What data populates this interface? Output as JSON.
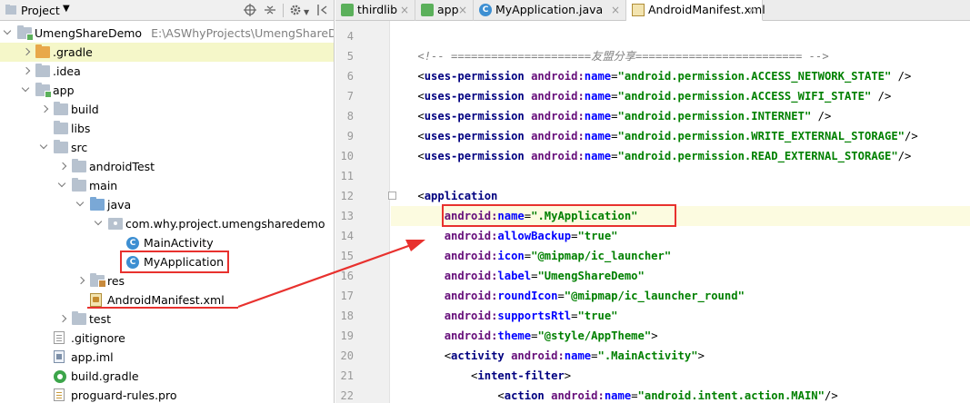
{
  "project_panel": {
    "title": "Project",
    "toolbar_icons": [
      "target-icon",
      "collapse-icon",
      "gear-icon",
      "hide-icon"
    ],
    "tree": [
      {
        "label": "UmengShareDemo",
        "path": "E:\\ASWhyProjects\\UmengShareDemo",
        "icon": "module-folder-icon",
        "arrow": "expanded",
        "depth": 0
      },
      {
        "label": ".gradle",
        "icon": "orange-folder-icon",
        "arrow": "collapsed",
        "depth": 1,
        "selected": true
      },
      {
        "label": ".idea",
        "icon": "folder-icon",
        "arrow": "collapsed",
        "depth": 1
      },
      {
        "label": "app",
        "icon": "module-folder-icon",
        "arrow": "expanded",
        "depth": 1
      },
      {
        "label": "build",
        "icon": "folder-icon",
        "arrow": "collapsed",
        "depth": 2
      },
      {
        "label": "libs",
        "icon": "folder-icon",
        "arrow": "none",
        "depth": 2
      },
      {
        "label": "src",
        "icon": "folder-icon",
        "arrow": "expanded",
        "depth": 2
      },
      {
        "label": "androidTest",
        "icon": "folder-icon",
        "arrow": "collapsed",
        "depth": 3
      },
      {
        "label": "main",
        "icon": "folder-icon",
        "arrow": "expanded",
        "depth": 3
      },
      {
        "label": "java",
        "icon": "source-folder-icon",
        "arrow": "expanded",
        "depth": 4
      },
      {
        "label": "com.why.project.umengsharedemo",
        "icon": "package-icon",
        "arrow": "expanded",
        "depth": 5
      },
      {
        "label": "MainActivity",
        "icon": "java-class-icon",
        "arrow": "none",
        "depth": 6
      },
      {
        "label": "MyApplication",
        "icon": "java-class-icon",
        "arrow": "none",
        "depth": 6,
        "highlight": true
      },
      {
        "label": "res",
        "icon": "res-folder-icon",
        "arrow": "collapsed",
        "depth": 4
      },
      {
        "label": "AndroidManifest.xml",
        "icon": "manifest-file-icon",
        "arrow": "none",
        "depth": 4,
        "underline": true
      },
      {
        "label": "test",
        "icon": "folder-icon",
        "arrow": "collapsed",
        "depth": 3
      },
      {
        "label": ".gitignore",
        "icon": "gitignore-file-icon",
        "arrow": "none",
        "depth": 2
      },
      {
        "label": "app.iml",
        "icon": "iml-file-icon",
        "arrow": "none",
        "depth": 2
      },
      {
        "label": "build.gradle",
        "icon": "gradle-file-icon",
        "arrow": "none",
        "depth": 2
      },
      {
        "label": "proguard-rules.pro",
        "icon": "pro-file-icon",
        "arrow": "none",
        "depth": 2
      }
    ]
  },
  "editor": {
    "tabs": [
      {
        "label": "thirdlib",
        "icon": "module-icon",
        "active": false
      },
      {
        "label": "app",
        "icon": "module-icon",
        "active": false
      },
      {
        "label": "MyApplication.java",
        "icon": "java-class-icon",
        "active": false
      },
      {
        "label": "AndroidManifest.xml",
        "icon": "manifest-file-icon",
        "active": true
      }
    ],
    "close_glyph": "×",
    "lines": [
      {
        "n": "4",
        "tokens": []
      },
      {
        "n": "5",
        "tokens": [
          {
            "t": "    ",
            "c": ""
          },
          {
            "t": "<!-- =====================友盟分享========================= -->",
            "c": "cmt"
          }
        ]
      },
      {
        "n": "6",
        "tokens": [
          {
            "t": "    <",
            "c": "br"
          },
          {
            "t": "uses-permission ",
            "c": "tag"
          },
          {
            "t": "android:",
            "c": "attr"
          },
          {
            "t": "name",
            "c": "attrp"
          },
          {
            "t": "=",
            "c": "br"
          },
          {
            "t": "\"android.permission.ACCESS_NETWORK_STATE\"",
            "c": "str"
          },
          {
            "t": " />",
            "c": "br"
          }
        ]
      },
      {
        "n": "7",
        "tokens": [
          {
            "t": "    <",
            "c": "br"
          },
          {
            "t": "uses-permission ",
            "c": "tag"
          },
          {
            "t": "android:",
            "c": "attr"
          },
          {
            "t": "name",
            "c": "attrp"
          },
          {
            "t": "=",
            "c": "br"
          },
          {
            "t": "\"android.permission.ACCESS_WIFI_STATE\"",
            "c": "str"
          },
          {
            "t": " />",
            "c": "br"
          }
        ]
      },
      {
        "n": "8",
        "tokens": [
          {
            "t": "    <",
            "c": "br"
          },
          {
            "t": "uses-permission ",
            "c": "tag"
          },
          {
            "t": "android:",
            "c": "attr"
          },
          {
            "t": "name",
            "c": "attrp"
          },
          {
            "t": "=",
            "c": "br"
          },
          {
            "t": "\"android.permission.INTERNET\"",
            "c": "str"
          },
          {
            "t": " />",
            "c": "br"
          }
        ]
      },
      {
        "n": "9",
        "tokens": [
          {
            "t": "    <",
            "c": "br"
          },
          {
            "t": "uses-permission ",
            "c": "tag"
          },
          {
            "t": "android:",
            "c": "attr"
          },
          {
            "t": "name",
            "c": "attrp"
          },
          {
            "t": "=",
            "c": "br"
          },
          {
            "t": "\"android.permission.WRITE_EXTERNAL_STORAGE\"",
            "c": "str"
          },
          {
            "t": "/>",
            "c": "br"
          }
        ]
      },
      {
        "n": "10",
        "tokens": [
          {
            "t": "    <",
            "c": "br"
          },
          {
            "t": "uses-permission ",
            "c": "tag"
          },
          {
            "t": "android:",
            "c": "attr"
          },
          {
            "t": "name",
            "c": "attrp"
          },
          {
            "t": "=",
            "c": "br"
          },
          {
            "t": "\"android.permission.READ_EXTERNAL_STORAGE\"",
            "c": "str"
          },
          {
            "t": "/>",
            "c": "br"
          }
        ]
      },
      {
        "n": "11",
        "tokens": []
      },
      {
        "n": "12",
        "tokens": [
          {
            "t": "    <",
            "c": "br"
          },
          {
            "t": "application",
            "c": "tag"
          }
        ]
      },
      {
        "n": "13",
        "tokens": [
          {
            "t": "        ",
            "c": ""
          },
          {
            "t": "android:",
            "c": "attr"
          },
          {
            "t": "name",
            "c": "attrp"
          },
          {
            "t": "=",
            "c": "br"
          },
          {
            "t": "\".MyApplication\"",
            "c": "str"
          }
        ],
        "highlight": true
      },
      {
        "n": "14",
        "tokens": [
          {
            "t": "        ",
            "c": ""
          },
          {
            "t": "android:",
            "c": "attr"
          },
          {
            "t": "allowBackup",
            "c": "attrp"
          },
          {
            "t": "=",
            "c": "br"
          },
          {
            "t": "\"true\"",
            "c": "str"
          }
        ]
      },
      {
        "n": "15",
        "tokens": [
          {
            "t": "        ",
            "c": ""
          },
          {
            "t": "android:",
            "c": "attr"
          },
          {
            "t": "icon",
            "c": "attrp"
          },
          {
            "t": "=",
            "c": "br"
          },
          {
            "t": "\"@mipmap/ic_launcher\"",
            "c": "str"
          }
        ]
      },
      {
        "n": "16",
        "tokens": [
          {
            "t": "        ",
            "c": ""
          },
          {
            "t": "android:",
            "c": "attr"
          },
          {
            "t": "label",
            "c": "attrp"
          },
          {
            "t": "=",
            "c": "br"
          },
          {
            "t": "\"UmengShareDemo\"",
            "c": "str"
          }
        ]
      },
      {
        "n": "17",
        "tokens": [
          {
            "t": "        ",
            "c": ""
          },
          {
            "t": "android:",
            "c": "attr"
          },
          {
            "t": "roundIcon",
            "c": "attrp"
          },
          {
            "t": "=",
            "c": "br"
          },
          {
            "t": "\"@mipmap/ic_launcher_round\"",
            "c": "str"
          }
        ]
      },
      {
        "n": "18",
        "tokens": [
          {
            "t": "        ",
            "c": ""
          },
          {
            "t": "android:",
            "c": "attr"
          },
          {
            "t": "supportsRtl",
            "c": "attrp"
          },
          {
            "t": "=",
            "c": "br"
          },
          {
            "t": "\"true\"",
            "c": "str"
          }
        ]
      },
      {
        "n": "19",
        "tokens": [
          {
            "t": "        ",
            "c": ""
          },
          {
            "t": "android:",
            "c": "attr"
          },
          {
            "t": "theme",
            "c": "attrp"
          },
          {
            "t": "=",
            "c": "br"
          },
          {
            "t": "\"@style/AppTheme\"",
            "c": "str"
          },
          {
            "t": ">",
            "c": "br"
          }
        ]
      },
      {
        "n": "20",
        "tokens": [
          {
            "t": "        <",
            "c": "br"
          },
          {
            "t": "activity ",
            "c": "tag"
          },
          {
            "t": "android:",
            "c": "attr"
          },
          {
            "t": "name",
            "c": "attrp"
          },
          {
            "t": "=",
            "c": "br"
          },
          {
            "t": "\".MainActivity\"",
            "c": "str"
          },
          {
            "t": ">",
            "c": "br"
          }
        ]
      },
      {
        "n": "21",
        "tokens": [
          {
            "t": "            <",
            "c": "br"
          },
          {
            "t": "intent-filter",
            "c": "tag"
          },
          {
            "t": ">",
            "c": "br"
          }
        ]
      },
      {
        "n": "22",
        "tokens": [
          {
            "t": "                <",
            "c": "br"
          },
          {
            "t": "action ",
            "c": "tag"
          },
          {
            "t": "android:",
            "c": "attr"
          },
          {
            "t": "name",
            "c": "attrp"
          },
          {
            "t": "=",
            "c": "br"
          },
          {
            "t": "\"android.intent.action.MAIN\"",
            "c": "str"
          },
          {
            "t": "/>",
            "c": "br"
          }
        ]
      }
    ]
  },
  "annotation": {
    "color": "#e8312e"
  }
}
